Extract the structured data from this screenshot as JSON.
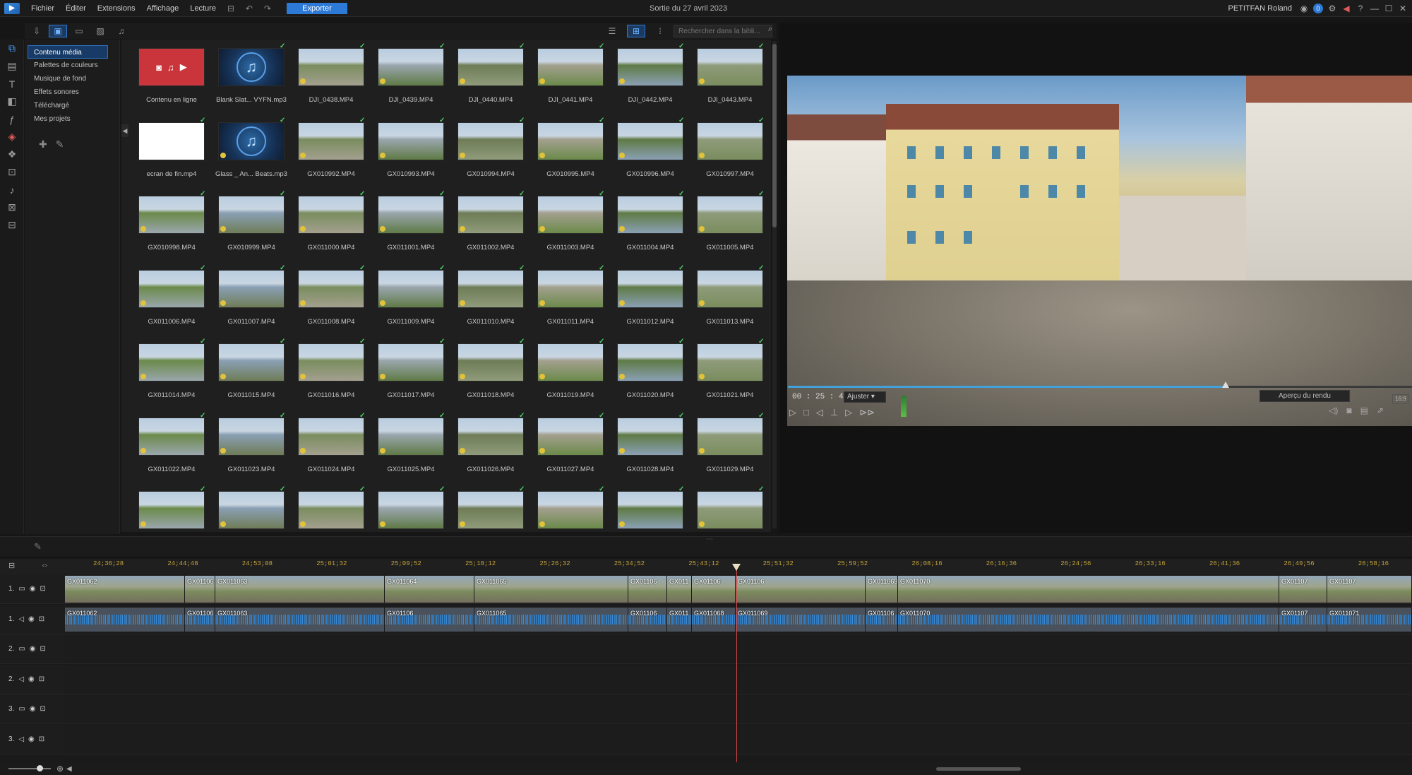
{
  "menu": {
    "items": [
      "Fichier",
      "Éditer",
      "Extensions",
      "Affichage",
      "Lecture"
    ],
    "export_label": "Exporter",
    "project_title": "Sortie du 27 avril 2023",
    "user": "PETITFAN Roland"
  },
  "colors": {
    "accent": "#2d7ad6",
    "playhead": "#d64545",
    "ruler_text": "#c6a43a",
    "check": "#4bd06a"
  },
  "tree": {
    "items": [
      "Contenu média",
      "Palettes de couleurs",
      "Musique de fond",
      "Effets sonores",
      "Téléchargé",
      "Mes projets"
    ]
  },
  "library": {
    "search_placeholder": "Rechercher dans la bibli...",
    "tiles": [
      "Contenu en ligne",
      "Blank Slat... VYFN.mp3",
      "DJI_0438.MP4",
      "DJI_0439.MP4",
      "DJI_0440.MP4",
      "DJI_0441.MP4",
      "DJI_0442.MP4",
      "DJI_0443.MP4",
      "ecran de fin.mp4",
      "Glass _ An... Beats.mp3",
      "GX010992.MP4",
      "GX010993.MP4",
      "GX010994.MP4",
      "GX010995.MP4",
      "GX010996.MP4",
      "GX010997.MP4",
      "GX010998.MP4",
      "GX010999.MP4",
      "GX011000.MP4",
      "GX011001.MP4",
      "GX011002.MP4",
      "GX011003.MP4",
      "GX011004.MP4",
      "GX011005.MP4",
      "GX011006.MP4",
      "GX011007.MP4",
      "GX011008.MP4",
      "GX011009.MP4",
      "GX011010.MP4",
      "GX011011.MP4",
      "GX011012.MP4",
      "GX011013.MP4",
      "GX011014.MP4",
      "GX011015.MP4",
      "GX011016.MP4",
      "GX011017.MP4",
      "GX011018.MP4",
      "GX011019.MP4",
      "GX011020.MP4",
      "GX011021.MP4",
      "GX011022.MP4",
      "GX011023.MP4",
      "GX011024.MP4",
      "GX011025.MP4",
      "GX011026.MP4",
      "GX011027.MP4",
      "GX011028.MP4",
      "GX011029.MP4",
      "",
      "",
      "",
      "",
      "",
      "",
      "",
      ""
    ]
  },
  "preview": {
    "timecode": "00 : 25 : 48 : 43",
    "fit_label": "Ajuster",
    "render_label": "Aperçu du rendu",
    "ratio_label": "16:9",
    "progress": 0.7
  },
  "timeline": {
    "ruler": [
      "24;36;28",
      "24;44;48",
      "24;53;08",
      "25;01;32",
      "25;09;52",
      "25;18;12",
      "25;26;32",
      "25;34;52",
      "25;43;12",
      "25;51;32",
      "25;59;52",
      "26;08;16",
      "26;16;36",
      "26;24;56",
      "26;33;16",
      "26;41;36",
      "26;49;56",
      "26;58;16"
    ],
    "tracks": [
      {
        "label": "1.",
        "type": "video"
      },
      {
        "label": "1.",
        "type": "audio"
      },
      {
        "label": "2.",
        "type": "video"
      },
      {
        "label": "2.",
        "type": "audio"
      },
      {
        "label": "3.",
        "type": "video"
      },
      {
        "label": "3.",
        "type": "audio"
      }
    ],
    "video_clips": [
      "GX011062",
      "GX01106",
      "GX011063",
      "GX011064",
      "GX011065",
      "GX01106",
      "GX011",
      "GX01106",
      "GX01106",
      "GX011069",
      "GX011070",
      "GX01107",
      "GX01107"
    ],
    "audio_clips": [
      "GX011062",
      "GX01106",
      "GX011063",
      "GX01106",
      "GX011065",
      "GX01106",
      "GX011",
      "GX011068",
      "GX011069",
      "GX01106",
      "GX011070",
      "GX01107",
      "GX011071"
    ]
  }
}
